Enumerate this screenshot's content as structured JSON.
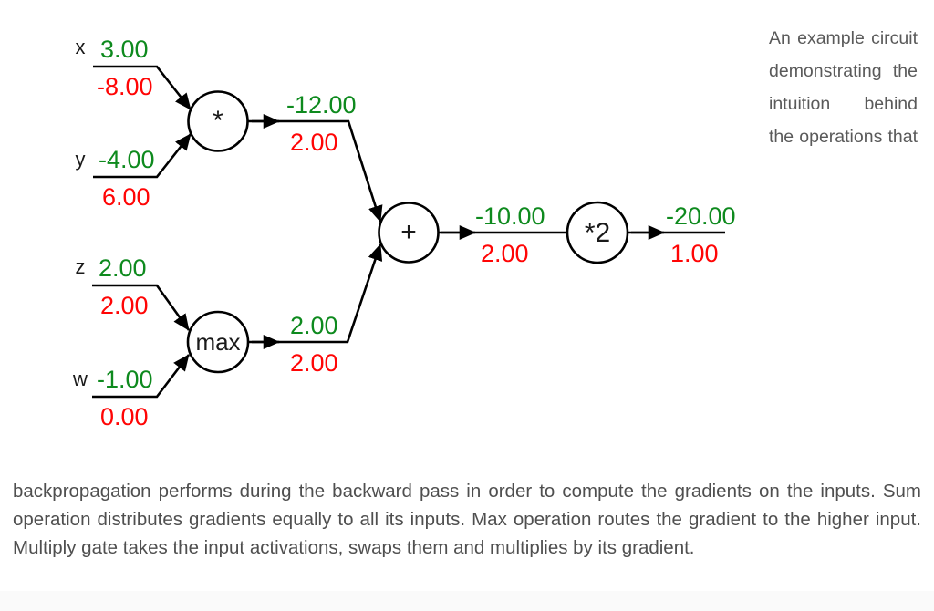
{
  "figure": {
    "inputs": [
      {
        "name": "x",
        "forward": "3.00",
        "backward": "-8.00"
      },
      {
        "name": "y",
        "forward": "-4.00",
        "backward": "6.00"
      },
      {
        "name": "z",
        "forward": "2.00",
        "backward": "2.00"
      },
      {
        "name": "w",
        "forward": "-1.00",
        "backward": "0.00"
      }
    ],
    "gates": [
      {
        "id": "mul-gate",
        "label": "*"
      },
      {
        "id": "max-gate",
        "label": "max"
      },
      {
        "id": "add-gate",
        "label": "+"
      },
      {
        "id": "times2-gate",
        "label": "*2"
      }
    ],
    "edges": [
      {
        "id": "mul-output",
        "forward": "-12.00",
        "backward": "2.00"
      },
      {
        "id": "max-output",
        "forward": "2.00",
        "backward": "2.00"
      },
      {
        "id": "add-output",
        "forward": "-10.00",
        "backward": "2.00"
      },
      {
        "id": "final-output",
        "forward": "-20.00",
        "backward": "1.00"
      }
    ],
    "colors": {
      "forward": "#0e8a1e",
      "backward": "#ff0505",
      "wire": "#000000",
      "label": "#1a1a1a"
    }
  },
  "side_caption": "An example circuit demonstrating the intuition behind the operations that",
  "bottom_paragraph": "backpropagation performs during the backward pass in order to compute the gradients on the inputs. Sum operation distributes gradients equally to all its inputs. Max operation routes the gradient to the higher input. Multiply gate takes the input activations, swaps them and multiplies by its gradient."
}
